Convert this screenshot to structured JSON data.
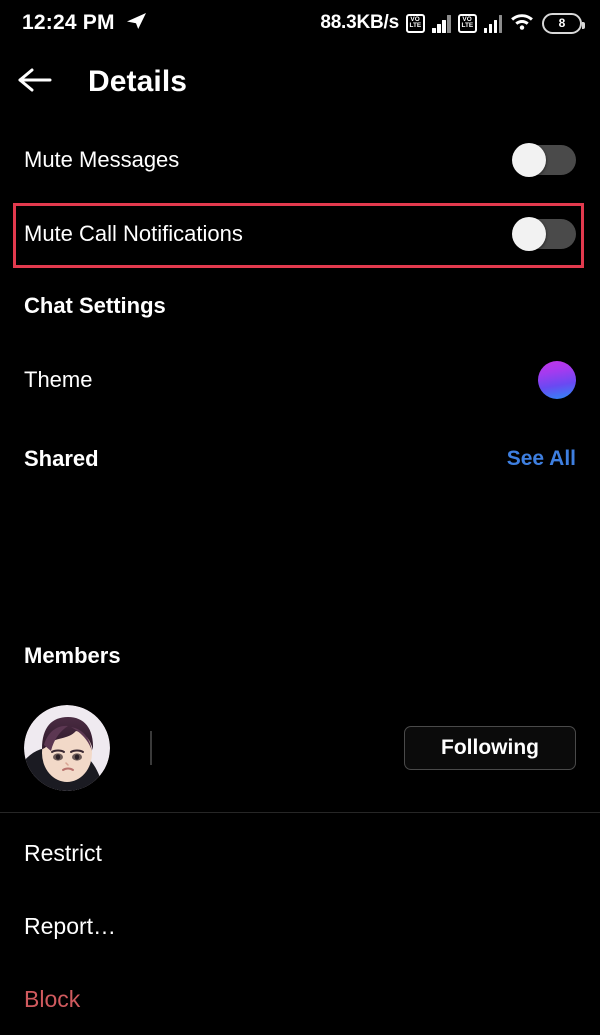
{
  "status_bar": {
    "clock": "12:24 PM",
    "telegram_icon": "paper-plane-icon",
    "network_speed": "88.3KB/s",
    "volte_label_top": "VO",
    "volte_label_bottom": "LTE",
    "sim1_signal_icon": "signal-bars-icon",
    "sim2_signal_icon": "signal-bars-icon",
    "wifi_icon": "wifi-icon",
    "battery_level": "8"
  },
  "header": {
    "back_icon": "arrow-left-icon",
    "title": "Details"
  },
  "notifications": {
    "mute_messages": {
      "label": "Mute Messages",
      "state": "off"
    },
    "mute_call_notifications": {
      "label": "Mute Call Notifications",
      "state": "off",
      "highlighted": true,
      "highlight_color": "#e23a4e"
    }
  },
  "chat_settings": {
    "section_title": "Chat Settings",
    "theme": {
      "label": "Theme",
      "swatch_icon": "theme-gradient-circle",
      "gradient_from": "#c335e8",
      "gradient_to": "#2d8cf5"
    }
  },
  "shared": {
    "section_title": "Shared",
    "see_all_label": "See All",
    "see_all_color": "#3e7fe0"
  },
  "members": {
    "section_title": "Members",
    "list": [
      {
        "avatar_icon": "user-avatar-anime",
        "username": "",
        "action_label": "Following"
      }
    ]
  },
  "actions": [
    {
      "label": "Restrict",
      "danger": false
    },
    {
      "label": "Report…",
      "danger": false
    },
    {
      "label": "Block",
      "danger": true
    }
  ],
  "colors": {
    "background": "#000000",
    "text": "#ffffff",
    "danger": "#d05a5e",
    "accent_blue": "#3e7fe0",
    "divider": "#262626",
    "toggle_track_off": "#4a4a4a",
    "toggle_knob": "#f2f2f2"
  }
}
